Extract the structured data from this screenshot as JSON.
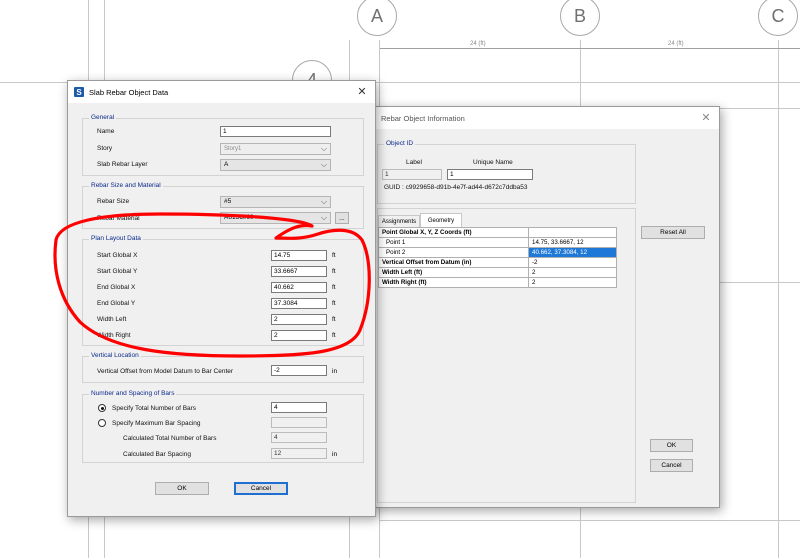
{
  "grid": {
    "bubbles": [
      "A",
      "B",
      "C",
      "4"
    ],
    "dimensions": [
      "24 (ft)",
      "24 (ft)"
    ]
  },
  "slab_dialog": {
    "title": "Slab Rebar Object Data",
    "title_icon": "S",
    "general": {
      "legend": "General",
      "name_label": "Name",
      "name_value": "1",
      "story_label": "Story",
      "story_value": "Story1",
      "layer_label": "Slab Rebar Layer",
      "layer_value": "A"
    },
    "rebar_size": {
      "legend": "Rebar Size and Material",
      "size_label": "Rebar Size",
      "size_value": "#5",
      "material_label": "Rebar Material",
      "material_value": "A615Gr60",
      "browse_label": "..."
    },
    "plan_layout": {
      "legend": "Plan Layout Data",
      "rows": [
        {
          "label": "Start Global X",
          "value": "14.75",
          "unit": "ft"
        },
        {
          "label": "Start Global Y",
          "value": "33.6667",
          "unit": "ft"
        },
        {
          "label": "End Global X",
          "value": "40.662",
          "unit": "ft"
        },
        {
          "label": "End Global Y",
          "value": "37.3084",
          "unit": "ft"
        },
        {
          "label": "Width Left",
          "value": "2",
          "unit": "ft"
        },
        {
          "label": "Width Right",
          "value": "2",
          "unit": "ft"
        }
      ]
    },
    "vertical": {
      "legend": "Vertical Location",
      "offset_label": "Vertical Offset from Model Datum to Bar Center",
      "offset_value": "-2",
      "offset_unit": "in"
    },
    "bars": {
      "legend": "Number and Spacing of Bars",
      "opt_total_label": "Specify Total Number of Bars",
      "opt_total_value": "4",
      "opt_spacing_label": "Specify Maximum Bar Spacing",
      "opt_spacing_value": "",
      "calc_total_label": "Calculated Total Number of Bars",
      "calc_total_value": "4",
      "calc_spacing_label": "Calculated Bar Spacing",
      "calc_spacing_value": "12",
      "calc_spacing_unit": "in",
      "selected_option": "total"
    },
    "ok_label": "OK",
    "cancel_label": "Cancel",
    "close_label": "✕"
  },
  "info_dialog": {
    "title": "Rebar Object Information",
    "close_label": "✕",
    "object_id": {
      "legend": "Object ID",
      "label_header": "Label",
      "label_value": "1",
      "unique_header": "Unique Name",
      "unique_value": "1",
      "guid": "GUID : c9929658-d91b-4e7f-ad44-d672c7ddba53"
    },
    "tabs": [
      "Assignments",
      "Geometry"
    ],
    "active_tab": "Geometry",
    "table": [
      {
        "name": "Point Global X, Y, Z Coords  (ft)",
        "value": "",
        "bold": true
      },
      {
        "name": "Point 1",
        "value": "14.75, 33.6667, 12",
        "bold": false
      },
      {
        "name": "Point 2",
        "value": "40.662, 37.3084, 12",
        "bold": false,
        "selected": true
      },
      {
        "name": "Vertical Offset from Datum  (in)",
        "value": "-2",
        "bold": true
      },
      {
        "name": "Width Left  (ft)",
        "value": "2",
        "bold": true
      },
      {
        "name": "Width Right  (ft)",
        "value": "2",
        "bold": true
      }
    ],
    "reset_label": "Reset All",
    "ok_label": "OK",
    "cancel_label": "Cancel"
  },
  "colors": {
    "annotation": "#ff0000",
    "selection": "#1e78d7",
    "group_title": "#0a2a8a"
  }
}
